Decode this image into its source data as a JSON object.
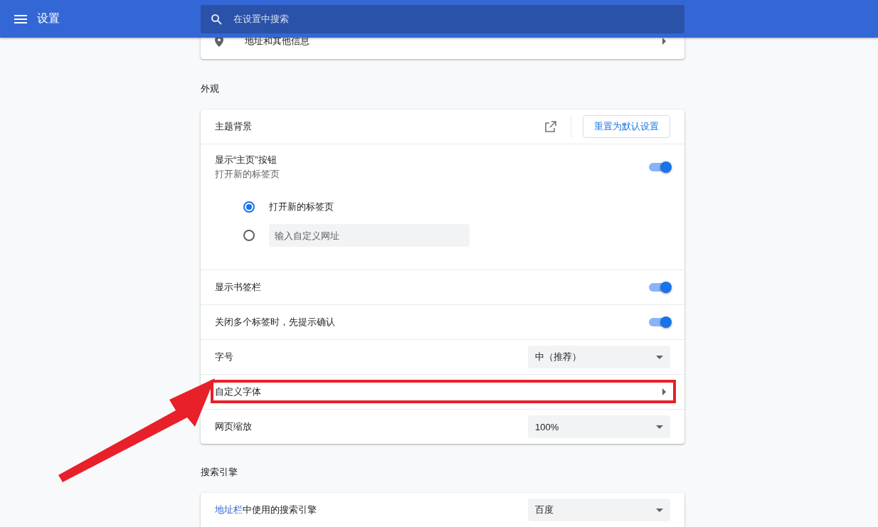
{
  "header": {
    "title": "设置",
    "search": {
      "placeholder": "在设置中搜索"
    }
  },
  "top_card": {
    "label": "地址和其他信息"
  },
  "appearance": {
    "heading": "外观",
    "theme": {
      "label": "主题背景",
      "button": "重置为默认设置"
    },
    "home_button": {
      "label": "显示“主页”按钮",
      "sublabel": "打开新的标签页",
      "on": true,
      "options": [
        {
          "kind": "text",
          "label": "打开新的标签页",
          "selected": true
        },
        {
          "kind": "input",
          "placeholder": "输入自定义网址",
          "selected": false
        }
      ]
    },
    "rows": [
      {
        "kind": "toggle",
        "label": "显示书签栏",
        "on": true
      },
      {
        "kind": "toggle",
        "label": "关闭多个标签时，先提示确认",
        "on": true
      },
      {
        "kind": "select",
        "label": "字号",
        "value": "中（推荐）"
      },
      {
        "kind": "link",
        "label": "自定义字体",
        "highlighted": true
      },
      {
        "kind": "select",
        "label": "网页缩放",
        "value": "100%"
      }
    ]
  },
  "search_engine": {
    "heading": "搜索引擎",
    "row": {
      "link": "地址栏",
      "label": "中使用的搜索引擎",
      "value": "百度"
    }
  }
}
